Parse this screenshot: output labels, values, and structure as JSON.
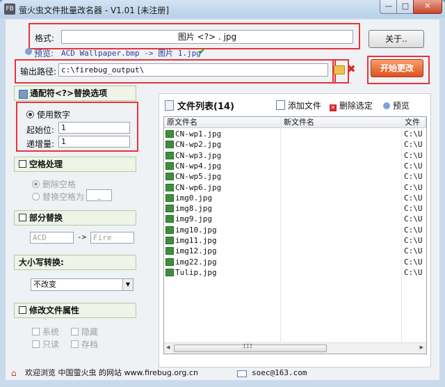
{
  "window": {
    "title": "萤火虫文件批量改名器 - V1.01  [未注册]",
    "app_icon_text": "FB",
    "minimize": "—",
    "maximize": "□",
    "close": "✕"
  },
  "format": {
    "label": "格式:",
    "value": "图片 <?> . jpg",
    "preview_label": "预览:",
    "preview_value": "ACD Wallpaper.bmp -> 图片 1.jpg"
  },
  "output": {
    "label": "输出路径:",
    "value": "c:\\firebug_output\\"
  },
  "buttons": {
    "about": "关于..",
    "start": "开始更改"
  },
  "wildcard": {
    "title": "通配符<?>替换选项",
    "use_number": "使用数字",
    "start_label": "起始位:",
    "start_value": "1",
    "increment_label": "递增量:",
    "increment_value": "1"
  },
  "space": {
    "title": "空格处理",
    "remove": "删除空格",
    "replace": "替换空格为",
    "replace_value": "_"
  },
  "partial": {
    "title": "部分替换",
    "from_value": "ACD",
    "arrow": "->",
    "to_value": "Fire"
  },
  "case": {
    "title": "大小写转换:",
    "selected": "不改变"
  },
  "attributes": {
    "title": "修改文件属性",
    "system": "系统",
    "hidden": "隐藏",
    "readonly": "只读",
    "archive": "存档"
  },
  "filelist": {
    "title": "文件列表(14)",
    "add": "添加文件",
    "remove": "删除选定",
    "preview": "预览",
    "columns": [
      "原文件名",
      "新文件名",
      "文件"
    ],
    "rows": [
      {
        "orig": "CN-wp1.jpg",
        "path": "C:\\U"
      },
      {
        "orig": "CN-wp2.jpg",
        "path": "C:\\U"
      },
      {
        "orig": "CN-wp3.jpg",
        "path": "C:\\U"
      },
      {
        "orig": "CN-wp4.jpg",
        "path": "C:\\U"
      },
      {
        "orig": "CN-wp5.jpg",
        "path": "C:\\U"
      },
      {
        "orig": "CN-wp6.jpg",
        "path": "C:\\U"
      },
      {
        "orig": "img0.jpg",
        "path": "C:\\U"
      },
      {
        "orig": "img8.jpg",
        "path": "C:\\U"
      },
      {
        "orig": "img9.jpg",
        "path": "C:\\U"
      },
      {
        "orig": "img10.jpg",
        "path": "C:\\U"
      },
      {
        "orig": "img11.jpg",
        "path": "C:\\U"
      },
      {
        "orig": "img12.jpg",
        "path": "C:\\U"
      },
      {
        "orig": "img22.jpg",
        "path": "C:\\U"
      },
      {
        "orig": "Tulip.jpg",
        "path": "C:\\U"
      }
    ],
    "scroll_grip": "III"
  },
  "status": {
    "welcome": "欢迎浏览  中国萤火虫 的网站 www.firebug.org.cn",
    "email": "soec@163.com"
  }
}
